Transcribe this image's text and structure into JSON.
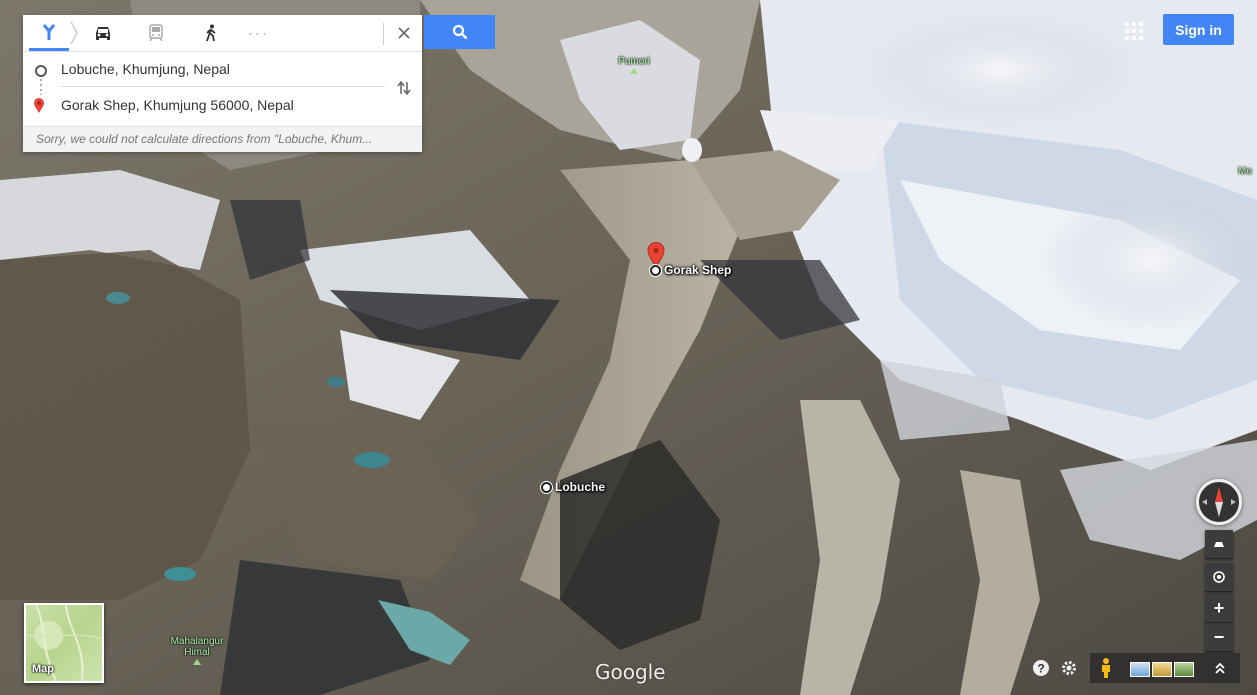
{
  "directions": {
    "modes": [
      {
        "name": "best-route",
        "icon": "directions-icon",
        "active": true
      },
      {
        "name": "driving",
        "icon": "car-icon"
      },
      {
        "name": "transit",
        "icon": "train-icon"
      },
      {
        "name": "walking",
        "icon": "walk-icon"
      }
    ],
    "more_label": "···",
    "from": "Lobuche, Khumjung, Nepal",
    "to": "Gorak Shep, Khumjung 56000, Nepal",
    "error": "Sorry, we could not calculate directions from \"Lobuche, Khum..."
  },
  "header": {
    "sign_in": "Sign in"
  },
  "map": {
    "places": {
      "gorak_shep": "Gorak Shep",
      "lobuche": "Lobuche"
    },
    "peaks": {
      "pumori": "Pumori",
      "mahalangur_l1": "Mahalangur",
      "mahalangur_l2": "Himal",
      "edge_fragment": "Mo"
    },
    "pin_color": "#ea4335"
  },
  "controls": {
    "map_toggle_label": "Map",
    "zoom_in": "+",
    "zoom_out": "−",
    "logo": "Google"
  },
  "colors": {
    "accent": "#4285f4"
  }
}
